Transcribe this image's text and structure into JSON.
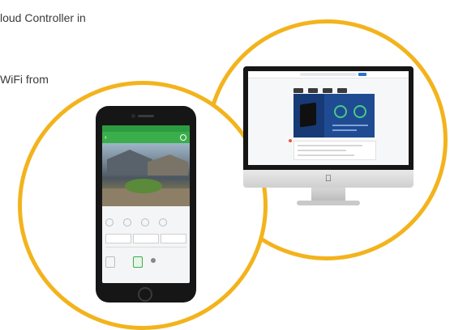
{
  "background_text": {
    "line1": "loud Controller in",
    "line2": "WiFi from"
  },
  "colors": {
    "accent_ring": "#f3b31c",
    "app_green": "#3aae4b",
    "desktop_panel": "#1f4b93"
  },
  "icons": [
    "apple-icon",
    "back-arrow-icon",
    "gear-icon",
    "home-button-icon"
  ]
}
